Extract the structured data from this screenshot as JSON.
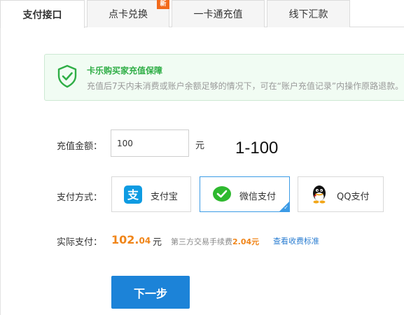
{
  "tabs": [
    {
      "label": "支付接口",
      "active": true
    },
    {
      "label": "点卡兑换",
      "badge": "新"
    },
    {
      "label": "一卡通充值"
    },
    {
      "label": "线下汇款"
    }
  ],
  "notice": {
    "icon": "shield-check-icon",
    "title": "卡乐购买家充值保障",
    "text": "充值后7天内未消费或账户余额足够的情况下，可在“账户充值记录”内操作原路退款。"
  },
  "amount": {
    "label": "充值金额：",
    "value": "100",
    "unit": "元",
    "range": "1-100"
  },
  "payment": {
    "label": "支付方式：",
    "methods": [
      {
        "label": "支付宝",
        "icon": "alipay-icon",
        "selected": false
      },
      {
        "label": "微信支付",
        "icon": "wechat-icon",
        "selected": true
      },
      {
        "label": "QQ支付",
        "icon": "qq-icon",
        "selected": false
      }
    ]
  },
  "actual": {
    "label": "实际支付：",
    "amount_int": "102.",
    "amount_dec": "04",
    "unit": "元",
    "fee_prefix": "第三方交易手续费",
    "fee_value": "2.04元",
    "fee_link": "查看收费标准"
  },
  "next_button": "下一步",
  "colors": {
    "accent_blue": "#1c83d8",
    "accent_green": "#2fae46",
    "accent_orange": "#f08519"
  }
}
